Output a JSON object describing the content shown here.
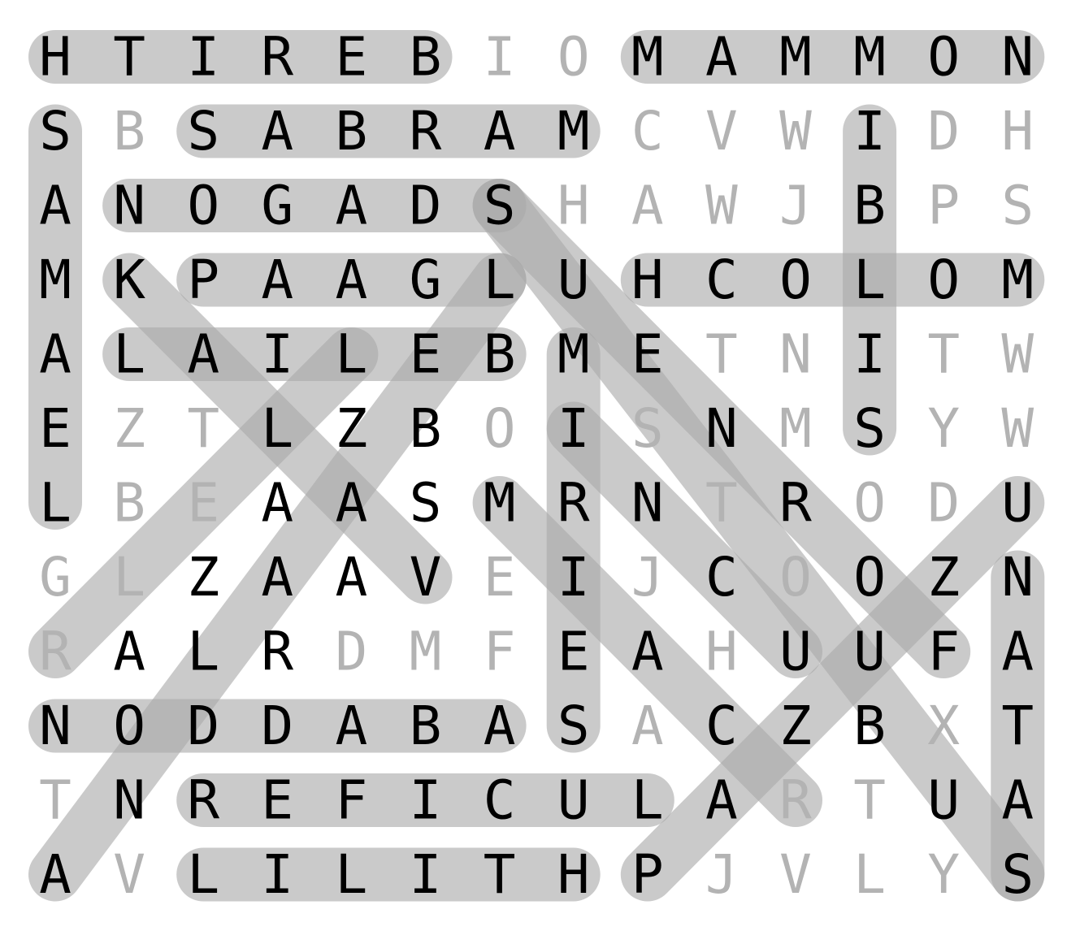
{
  "colors": {
    "background": "#ffffff",
    "highlight": "#a9a9a9",
    "found_letter": "#000000",
    "unused_letter": "#b3b3b3"
  },
  "grid": [
    [
      "H",
      "T",
      "I",
      "R",
      "E",
      "B",
      "I",
      "O",
      "M",
      "A",
      "M",
      "M",
      "O",
      "N"
    ],
    [
      "S",
      "B",
      "S",
      "A",
      "B",
      "R",
      "A",
      "M",
      "C",
      "V",
      "W",
      "I",
      "D",
      "H"
    ],
    [
      "A",
      "N",
      "O",
      "G",
      "A",
      "D",
      "S",
      "H",
      "A",
      "W",
      "J",
      "B",
      "P",
      "S"
    ],
    [
      "M",
      "K",
      "P",
      "A",
      "A",
      "G",
      "L",
      "U",
      "H",
      "C",
      "O",
      "L",
      "O",
      "M"
    ],
    [
      "A",
      "L",
      "A",
      "I",
      "L",
      "E",
      "B",
      "M",
      "E",
      "T",
      "N",
      "I",
      "T",
      "W"
    ],
    [
      "E",
      "Z",
      "T",
      "L",
      "Z",
      "B",
      "O",
      "I",
      "S",
      "N",
      "M",
      "S",
      "Y",
      "W"
    ],
    [
      "L",
      "B",
      "E",
      "A",
      "A",
      "S",
      "M",
      "R",
      "N",
      "T",
      "R",
      "O",
      "D",
      "U"
    ],
    [
      "G",
      "L",
      "Z",
      "A",
      "A",
      "V",
      "E",
      "I",
      "J",
      "C",
      "O",
      "O",
      "Z",
      "N"
    ],
    [
      "R",
      "A",
      "L",
      "R",
      "D",
      "M",
      "F",
      "E",
      "A",
      "H",
      "U",
      "U",
      "F",
      "A"
    ],
    [
      "N",
      "O",
      "D",
      "D",
      "A",
      "B",
      "A",
      "S",
      "A",
      "C",
      "Z",
      "B",
      "X",
      "T"
    ],
    [
      "T",
      "N",
      "R",
      "E",
      "F",
      "I",
      "C",
      "U",
      "L",
      "A",
      "R",
      "T",
      "U",
      "A"
    ],
    [
      "A",
      "V",
      "L",
      "I",
      "L",
      "I",
      "T",
      "H",
      "P",
      "J",
      "V",
      "L",
      "Y",
      "S"
    ]
  ],
  "words": [
    {
      "word": "BERITH",
      "start": [
        0,
        5
      ],
      "end": [
        0,
        0
      ]
    },
    {
      "word": "MAMMON",
      "start": [
        0,
        8
      ],
      "end": [
        0,
        13
      ]
    },
    {
      "word": "SAMAEL",
      "start": [
        1,
        0
      ],
      "end": [
        6,
        0
      ]
    },
    {
      "word": "SABRAM",
      "start": [
        1,
        2
      ],
      "end": [
        1,
        7
      ]
    },
    {
      "word": "IBLIS",
      "start": [
        1,
        11
      ],
      "end": [
        5,
        11
      ]
    },
    {
      "word": "NOGADS",
      "start": [
        2,
        1
      ],
      "end": [
        2,
        6
      ]
    },
    {
      "word": "PAAGL",
      "start": [
        3,
        2
      ],
      "end": [
        3,
        6
      ]
    },
    {
      "word": "MOLOCH",
      "start": [
        3,
        13
      ],
      "end": [
        3,
        8
      ]
    },
    {
      "word": "LAILEB",
      "start": [
        4,
        1
      ],
      "end": [
        4,
        6
      ]
    },
    {
      "word": "MIRIES",
      "start": [
        4,
        7
      ],
      "end": [
        9,
        7
      ]
    },
    {
      "word": "NODDABAS",
      "start": [
        9,
        0
      ],
      "end": [
        9,
        6
      ]
    },
    {
      "word": "LUCIFER",
      "start": [
        10,
        8
      ],
      "end": [
        10,
        2
      ]
    },
    {
      "word": "LILITH",
      "start": [
        11,
        2
      ],
      "end": [
        11,
        7
      ]
    },
    {
      "word": "SATAN",
      "start": [
        11,
        13
      ],
      "end": [
        7,
        13
      ]
    },
    {
      "word": "diag-1",
      "start": [
        2,
        6
      ],
      "end": [
        11,
        13
      ]
    },
    {
      "word": "diag-2",
      "start": [
        3,
        6
      ],
      "end": [
        11,
        0
      ]
    },
    {
      "word": "diag-3",
      "start": [
        3,
        1
      ],
      "end": [
        7,
        5
      ]
    },
    {
      "word": "diag-4",
      "start": [
        4,
        4
      ],
      "end": [
        8,
        0
      ]
    },
    {
      "word": "diag-5",
      "start": [
        5,
        7
      ],
      "end": [
        8,
        10
      ]
    },
    {
      "word": "diag-6",
      "start": [
        6,
        6
      ],
      "end": [
        10,
        10
      ]
    },
    {
      "word": "diag-7",
      "start": [
        6,
        13
      ],
      "end": [
        11,
        8
      ]
    },
    {
      "word": "diag-8",
      "start": [
        2,
        6
      ],
      "end": [
        8,
        12
      ]
    }
  ],
  "found_cells": [
    [
      0,
      0
    ],
    [
      0,
      1
    ],
    [
      0,
      2
    ],
    [
      0,
      3
    ],
    [
      0,
      4
    ],
    [
      0,
      5
    ],
    [
      0,
      8
    ],
    [
      0,
      9
    ],
    [
      0,
      10
    ],
    [
      0,
      11
    ],
    [
      0,
      12
    ],
    [
      0,
      13
    ],
    [
      1,
      0
    ],
    [
      1,
      2
    ],
    [
      1,
      3
    ],
    [
      1,
      4
    ],
    [
      1,
      5
    ],
    [
      1,
      6
    ],
    [
      1,
      7
    ],
    [
      1,
      11
    ],
    [
      2,
      0
    ],
    [
      2,
      1
    ],
    [
      2,
      2
    ],
    [
      2,
      3
    ],
    [
      2,
      4
    ],
    [
      2,
      5
    ],
    [
      2,
      6
    ],
    [
      2,
      11
    ],
    [
      3,
      0
    ],
    [
      3,
      1
    ],
    [
      3,
      2
    ],
    [
      3,
      3
    ],
    [
      3,
      4
    ],
    [
      3,
      5
    ],
    [
      3,
      6
    ],
    [
      3,
      7
    ],
    [
      3,
      8
    ],
    [
      3,
      9
    ],
    [
      3,
      10
    ],
    [
      3,
      11
    ],
    [
      3,
      12
    ],
    [
      3,
      13
    ],
    [
      4,
      0
    ],
    [
      4,
      1
    ],
    [
      4,
      2
    ],
    [
      4,
      3
    ],
    [
      4,
      4
    ],
    [
      4,
      5
    ],
    [
      4,
      6
    ],
    [
      4,
      7
    ],
    [
      4,
      8
    ],
    [
      4,
      11
    ],
    [
      5,
      0
    ],
    [
      5,
      3
    ],
    [
      5,
      4
    ],
    [
      5,
      5
    ],
    [
      5,
      7
    ],
    [
      5,
      9
    ],
    [
      5,
      11
    ],
    [
      6,
      0
    ],
    [
      6,
      3
    ],
    [
      6,
      4
    ],
    [
      6,
      5
    ],
    [
      6,
      6
    ],
    [
      6,
      7
    ],
    [
      6,
      8
    ],
    [
      6,
      10
    ],
    [
      6,
      13
    ],
    [
      7,
      2
    ],
    [
      7,
      3
    ],
    [
      7,
      4
    ],
    [
      7,
      5
    ],
    [
      7,
      7
    ],
    [
      7,
      9
    ],
    [
      7,
      11
    ],
    [
      7,
      12
    ],
    [
      7,
      13
    ],
    [
      8,
      1
    ],
    [
      8,
      2
    ],
    [
      8,
      3
    ],
    [
      8,
      7
    ],
    [
      8,
      8
    ],
    [
      8,
      10
    ],
    [
      8,
      11
    ],
    [
      8,
      12
    ],
    [
      8,
      13
    ],
    [
      9,
      0
    ],
    [
      9,
      1
    ],
    [
      9,
      2
    ],
    [
      9,
      3
    ],
    [
      9,
      4
    ],
    [
      9,
      5
    ],
    [
      9,
      6
    ],
    [
      9,
      7
    ],
    [
      9,
      9
    ],
    [
      9,
      10
    ],
    [
      9,
      11
    ],
    [
      9,
      13
    ],
    [
      10,
      1
    ],
    [
      10,
      2
    ],
    [
      10,
      3
    ],
    [
      10,
      4
    ],
    [
      10,
      5
    ],
    [
      10,
      6
    ],
    [
      10,
      7
    ],
    [
      10,
      8
    ],
    [
      10,
      9
    ],
    [
      10,
      12
    ],
    [
      10,
      13
    ],
    [
      11,
      0
    ],
    [
      11,
      2
    ],
    [
      11,
      3
    ],
    [
      11,
      4
    ],
    [
      11,
      5
    ],
    [
      11,
      6
    ],
    [
      11,
      7
    ],
    [
      11,
      8
    ],
    [
      11,
      13
    ]
  ]
}
